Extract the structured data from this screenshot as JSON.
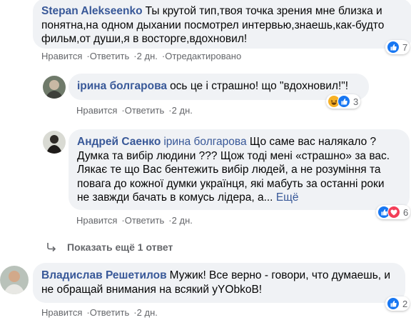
{
  "comments": [
    {
      "author": "Stepan Alekseenko",
      "text": "Ты крутой тип,твоя точка зрения мне близка и понятна,на одном дыхании посмотрел интервью,знаешь,как-будто фильм,от души,я в восторге,вдохновил!",
      "actions": {
        "like": "Нравится",
        "reply": "Ответить",
        "time": "2 дн.",
        "edited": "Отредактировано"
      },
      "reactions": {
        "count": "7",
        "icons": [
          "like-icon"
        ]
      }
    },
    {
      "author": "ірина болгарова",
      "text": "ось це і страшно! що \"вдохновил!\"!",
      "actions": {
        "like": "Нравится",
        "reply": "Ответить",
        "time": "2 дн."
      },
      "reactions": {
        "count": "3",
        "icons": [
          "haha-icon",
          "like-icon"
        ]
      }
    },
    {
      "author": "Андрей Саенко",
      "mention": "ірина болгарова",
      "text_lines": [
        "Що саме вас налякало ?",
        "Думка та вибір людини ??? Щож тоді мені «страшно» за вас.",
        "Лякає те що Вас бентежить вибір людей, а не розуміння та",
        "повага до кожної думки українця, які мабуть за останні роки",
        "не завжди бачать в комусь лідера, а..."
      ],
      "more": "Ещё",
      "actions": {
        "like": "Нравится",
        "reply": "Ответить",
        "time": "2 дн."
      },
      "reactions": {
        "count": "6",
        "icons": [
          "like-icon",
          "heart-icon"
        ]
      }
    },
    {
      "author": "Владислав Решетилов",
      "text": "Мужик! Все верно - говори, что думаешь, и не обращай внимания на всякий уYObkoB!",
      "actions": {
        "like": "Нравится",
        "reply": "Ответить",
        "time": "2 дн."
      },
      "reactions": {
        "count": "2",
        "icons": [
          "like-icon"
        ]
      }
    }
  ],
  "show_more_replies": "Показать ещё 1 ответ",
  "colors": {
    "bubble": "#f0f2f5",
    "link": "#385898",
    "muted": "#65676b",
    "like": "#1877f2",
    "heart": "#f33e58",
    "haha": "#f7b125"
  }
}
